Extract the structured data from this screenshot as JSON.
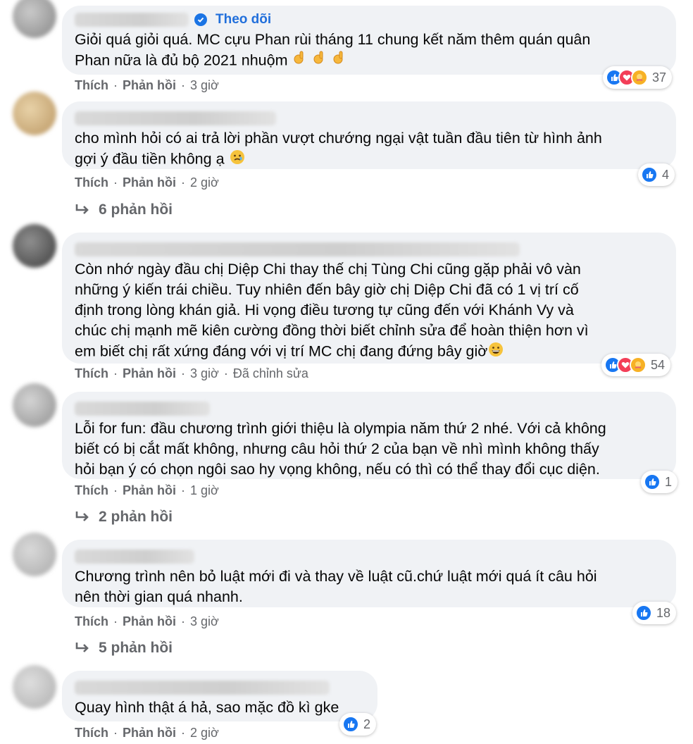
{
  "action_labels": {
    "like": "Thích",
    "reply": "Phản hồi",
    "separator": "·"
  },
  "comments": [
    {
      "follow_label": "Theo dõi",
      "text": [
        "Giỏi quá giỏi quá. MC cựu Phan rùi tháng 11 chung kết năm thêm quán quân",
        "Phan nữa là đủ bộ 2021 nhuộm"
      ],
      "emoji": "ok-hand-icon x3",
      "time": "3 giờ",
      "reaction_count": "37",
      "reaction_icons": [
        "like-icon",
        "love-icon",
        "care-icon"
      ]
    },
    {
      "text": [
        "cho mình hỏi có ai trả lời phần vượt chướng ngại vật tuần đầu tiên từ hình ảnh",
        "gợi ý đầu tiền không ạ"
      ],
      "emoji": "sad-smile-icon",
      "time": "2 giờ",
      "reaction_count": "4",
      "reaction_icons": [
        "like-icon"
      ],
      "replies": "6 phản hồi"
    },
    {
      "text": [
        "Còn nhớ ngày đầu chị Diệp Chi thay thế chị Tùng Chi cũng gặp phải vô vàn",
        "những ý kiến trái chiều. Tuy nhiên đến bây giờ chị Diệp Chi đã có 1 vị trí cố",
        "định trong lòng khán giả. Hi vọng điều tương tự cũng đến với Khánh Vy và",
        "chúc chị mạnh mẽ kiên cường đồng thời biết chỉnh sửa để hoàn thiện hơn vì",
        "em biết chị rất xứng đáng với vị trí MC chị đang đứng bây giờ"
      ],
      "emoji": "grin-icon",
      "time": "3 giờ",
      "edited": "Đã chỉnh sửa",
      "reaction_count": "54",
      "reaction_icons": [
        "like-icon",
        "love-icon",
        "care-icon"
      ]
    },
    {
      "text": [
        "Lỗi for fun: đầu chương trình giới thiệu là olympia năm thứ 2 nhé. Với cả không",
        "biết có bị cắt mất không, nhưng câu hỏi thứ 2 của bạn về nhì mình không thấy",
        "hỏi bạn ý có chọn ngôi sao hy vọng không, nếu có thì có thể thay đổi cục diện."
      ],
      "time": "1 giờ",
      "reaction_count": "1",
      "reaction_icons": [
        "like-icon"
      ],
      "replies": "2 phản hồi"
    },
    {
      "text": [
        "Chương trình nên bỏ luật mới đi và thay về luật cũ.chứ luật mới quá ít câu hỏi",
        "nên thời gian quá nhanh."
      ],
      "time": "3 giờ",
      "reaction_count": "18",
      "reaction_icons": [
        "like-icon"
      ],
      "replies": "5 phản hồi"
    },
    {
      "text": [
        "Quay hình thật á hả, sao mặc đồ kì gke"
      ],
      "time": "2 giờ",
      "reaction_count": "2",
      "reaction_icons": [
        "like-icon"
      ]
    }
  ]
}
